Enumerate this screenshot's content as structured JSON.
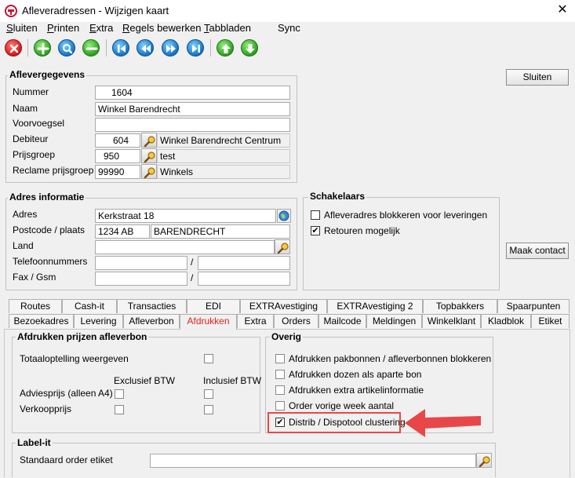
{
  "window": {
    "title": "Afleveradressen - Wijzigen kaart",
    "close": "✕"
  },
  "menu": [
    {
      "u": "S",
      "rest": "luiten"
    },
    {
      "u": "P",
      "rest": "rinten"
    },
    {
      "u": "E",
      "rest": "xtra"
    },
    {
      "u": "R",
      "rest": "egels bewerken"
    },
    {
      "u": "T",
      "rest": "abbladen"
    },
    {
      "u": "",
      "rest": "Sync"
    }
  ],
  "toolbar": [
    {
      "name": "close-icon",
      "color": "#d0161b"
    },
    {
      "name": "add-icon",
      "color": "#2e9d1f"
    },
    {
      "name": "search-icon",
      "color": "#1372c4"
    },
    {
      "name": "remove-icon",
      "color": "#2e9d1f"
    },
    {
      "name": "first-record-icon",
      "color": "#1372c4"
    },
    {
      "name": "previous-record-icon",
      "color": "#1372c4"
    },
    {
      "name": "next-record-icon",
      "color": "#1372c4"
    },
    {
      "name": "last-record-icon",
      "color": "#1372c4"
    },
    {
      "name": "arrow-up-icon",
      "color": "#2e9d1f"
    },
    {
      "name": "arrow-down-icon",
      "color": "#2e9d1f"
    }
  ],
  "buttons": {
    "sluiten": "Sluiten",
    "maak_contact": "Maak contact"
  },
  "aflevergegevens": {
    "title": "Aflevergegevens",
    "nummer_label": "Nummer",
    "nummer": "1604",
    "naam_label": "Naam",
    "naam": "Winkel Barendrecht",
    "voorvoegsel_label": "Voorvoegsel",
    "voorvoegsel": "",
    "debiteur_label": "Debiteur",
    "debiteur": "604",
    "debiteur_naam": "Winkel Barendrecht Centrum",
    "prijsgroep_label": "Prijsgroep",
    "prijsgroep": "950",
    "prijsgroep_naam": "test",
    "reclame_label": "Reclame prijsgroep",
    "reclame": "99990",
    "reclame_naam": "Winkels"
  },
  "adres": {
    "title": "Adres informatie",
    "adres_label": "Adres",
    "adres": "Kerkstraat 18",
    "postcode_label": "Postcode / plaats",
    "postcode": "1234 AB",
    "plaats": "BARENDRECHT",
    "land_label": "Land",
    "land": "",
    "telefoon_label": "Telefoonnummers",
    "fax_label": "Fax / Gsm",
    "slash": "/"
  },
  "schakelaars": {
    "title": "Schakelaars",
    "items": [
      {
        "label": "Afleveradres blokkeren voor leveringen",
        "checked": ""
      },
      {
        "label": "Retouren mogelijk",
        "checked": "✔"
      }
    ]
  },
  "tabs_row1": [
    "Routes",
    "Cash-it",
    "Transacties",
    "EDI",
    "EXTRAvestiging",
    "EXTRAvestiging 2",
    "Topbakkers",
    "Spaarpunten"
  ],
  "tabs_row2": [
    "Bezoekadres",
    "Levering",
    "Afleverbon",
    "Afdrukken",
    "Extra",
    "Orders",
    "Mailcode",
    "Meldingen",
    "Winkelklant",
    "Kladblok",
    "Etiket"
  ],
  "afdrukken_prijzen": {
    "title": "Afdrukken prijzen afleverbon",
    "totaal_label": "Totaaloptelling weergeven",
    "excl_header": "Exclusief BTW",
    "incl_header": "Inclusief BTW",
    "advies_label": "Adviesprijs (alleen A4)",
    "verkoop_label": "Verkoopprijs"
  },
  "overig": {
    "title": "Overig",
    "items": [
      {
        "label": "Afdrukken pakbonnen / afleverbonnen blokkeren",
        "checked": ""
      },
      {
        "label": "Afdrukken dozen als aparte bon",
        "checked": ""
      },
      {
        "label": "Afdrukken extra artikelinformatie",
        "checked": ""
      },
      {
        "label": "Order vorige week aantal",
        "checked": ""
      },
      {
        "label": "Distrib / Dispotool clustering",
        "checked": "✔"
      }
    ]
  },
  "labelit": {
    "title": "Label-it",
    "etiket_label": "Standaard order etiket",
    "etiket": ""
  }
}
